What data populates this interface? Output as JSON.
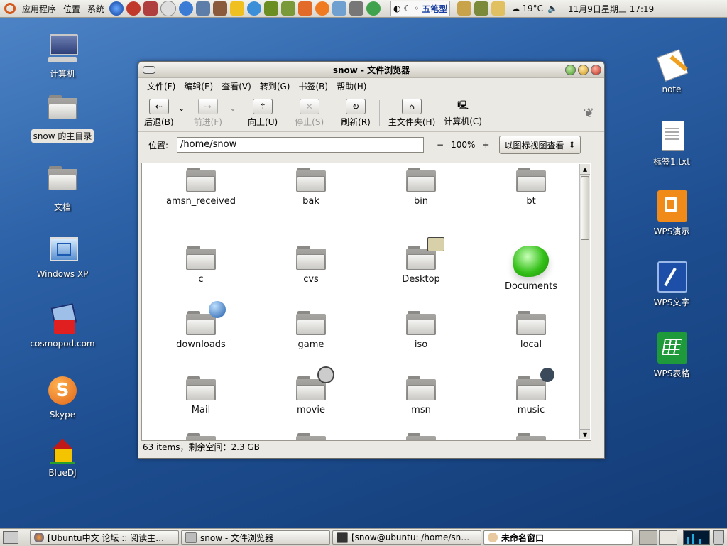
{
  "top_panel": {
    "menus": [
      "应用程序",
      "位置",
      "系统"
    ],
    "input_method": "五笔型",
    "weather": "19°C",
    "datetime": "11月9日星期三 17:19"
  },
  "desktop_icons_left": [
    {
      "label": "计算机",
      "icon": "computer-icon"
    },
    {
      "label": "snow 的主目录",
      "icon": "home-folder-icon"
    },
    {
      "label": "文档",
      "icon": "folder-icon"
    },
    {
      "label": "Windows XP",
      "icon": "vm-icon"
    },
    {
      "label": "cosmopod.com",
      "icon": "cosmopod-icon"
    },
    {
      "label": "Skype",
      "icon": "skype-icon"
    },
    {
      "label": "BlueDJ",
      "icon": "bluedj-icon"
    }
  ],
  "desktop_icons_right": [
    {
      "label": "note",
      "icon": "note-icon"
    },
    {
      "label": "标签1.txt",
      "icon": "text-file-icon"
    },
    {
      "label": "WPS演示",
      "icon": "wps-presentation-icon"
    },
    {
      "label": "WPS文字",
      "icon": "wps-writer-icon"
    },
    {
      "label": "WPS表格",
      "icon": "wps-spreadsheet-icon"
    }
  ],
  "window": {
    "title": "snow - 文件浏览器",
    "menu": [
      "文件(F)",
      "编辑(E)",
      "查看(V)",
      "转到(G)",
      "书签(B)",
      "帮助(H)"
    ],
    "toolbar": {
      "back": "后退(B)",
      "forward": "前进(F)",
      "up": "向上(U)",
      "stop": "停止(S)",
      "reload": "刷新(R)",
      "home": "主文件夹(H)",
      "computer": "计算机(C)"
    },
    "location_label": "位置:",
    "location_value": "/home/snow",
    "zoom_minus": "−",
    "zoom_level": "100%",
    "zoom_plus": "+",
    "view_mode": "以图标视图查看",
    "files": [
      {
        "name": "amsn_received",
        "emblem": ""
      },
      {
        "name": "bak",
        "emblem": ""
      },
      {
        "name": "bin",
        "emblem": ""
      },
      {
        "name": "bt",
        "emblem": ""
      },
      {
        "name": "c",
        "emblem": ""
      },
      {
        "name": "cvs",
        "emblem": ""
      },
      {
        "name": "Desktop",
        "emblem": "desktop-emblem"
      },
      {
        "name": "Documents",
        "emblem": "green-gem"
      },
      {
        "name": "downloads",
        "emblem": "globe-emblem"
      },
      {
        "name": "game",
        "emblem": ""
      },
      {
        "name": "iso",
        "emblem": ""
      },
      {
        "name": "local",
        "emblem": ""
      },
      {
        "name": "Mail",
        "emblem": ""
      },
      {
        "name": "movie",
        "emblem": "film-emblem"
      },
      {
        "name": "msn",
        "emblem": ""
      },
      {
        "name": "music",
        "emblem": "speaker-emblem"
      }
    ],
    "status": "63 items，剩余空间：2.3 GB"
  },
  "taskbar": [
    {
      "label": "[Ubuntu中文 论坛 :: 阅读主…",
      "icon": "firefox-icon",
      "active": false
    },
    {
      "label": "snow - 文件浏览器",
      "icon": "file-browser-icon",
      "active": false
    },
    {
      "label": "[snow@ubuntu: /home/sn…",
      "icon": "terminal-icon",
      "active": false
    },
    {
      "label": "未命名窗口",
      "icon": "gimp-icon",
      "active": true
    }
  ],
  "colors": {
    "accent": "#1d4d8f",
    "panel": "#e4e2dc"
  }
}
